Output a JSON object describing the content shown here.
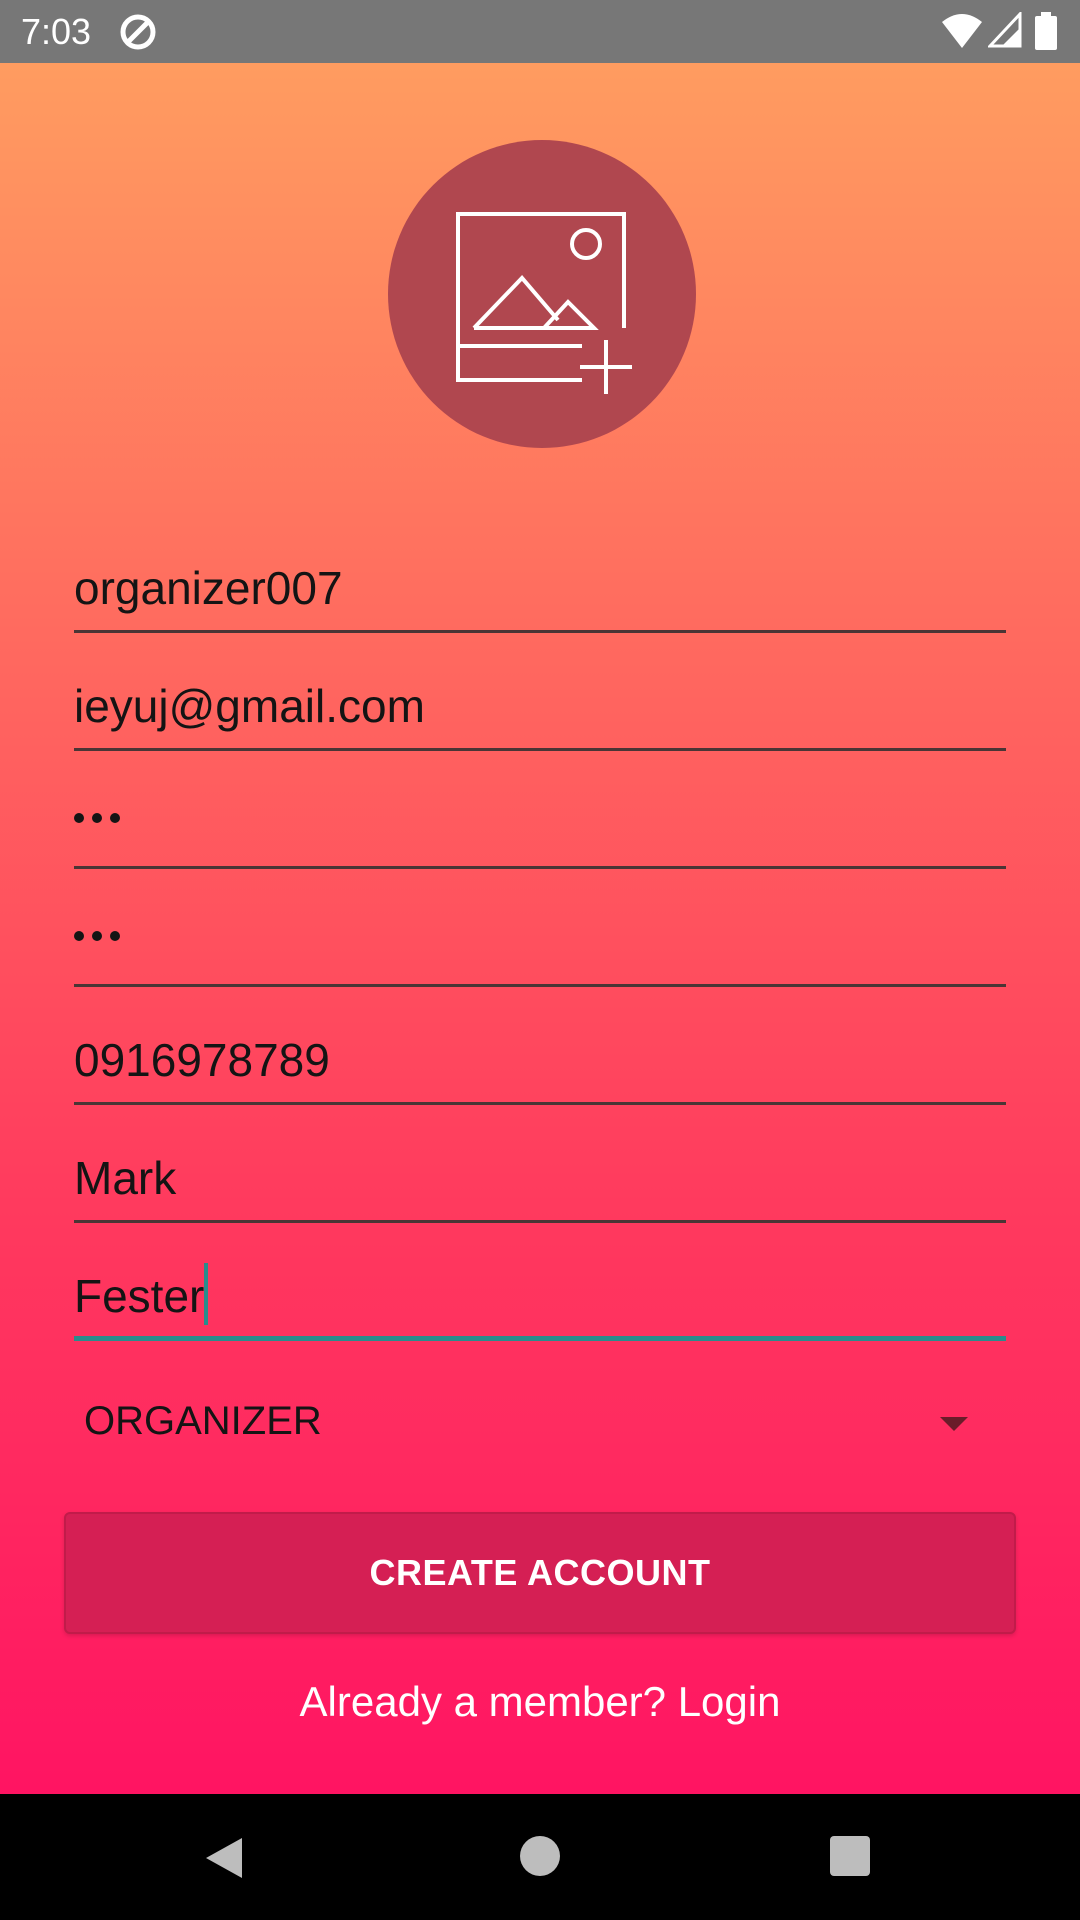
{
  "status_bar": {
    "time": "7:03",
    "icons": [
      "sync-icon",
      "wifi-icon",
      "signal-icon",
      "battery-icon"
    ]
  },
  "avatar": {
    "icon": "add-image-icon"
  },
  "form": {
    "username": {
      "value": "organizer007"
    },
    "email": {
      "value": "ieyuj@gmail.com"
    },
    "password": {
      "value": "•••",
      "masked_length": 3
    },
    "confirm_password": {
      "value": "•••",
      "masked_length": 3
    },
    "phone": {
      "value": "0916978789"
    },
    "first_name": {
      "value": "Mark"
    },
    "last_name": {
      "value": "Fester"
    },
    "role": {
      "selected": "ORGANIZER"
    }
  },
  "actions": {
    "create_account_label": "CREATE ACCOUNT",
    "login_link": "Already a member? Login"
  },
  "nav_bar": {
    "icons": [
      "back-icon",
      "home-icon",
      "recents-icon"
    ]
  },
  "colors": {
    "gradient_top": "#ff9c60",
    "gradient_bottom": "#ff1462",
    "button": "#d51f54",
    "focus_accent": "#2a8c8c",
    "avatar_bg": "#b0474f"
  }
}
